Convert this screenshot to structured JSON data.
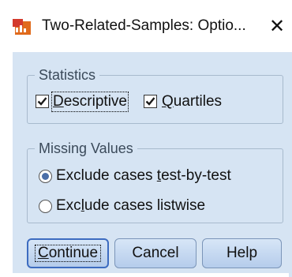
{
  "window": {
    "title": "Two-Related-Samples: Optio...",
    "icon": "spss-dialog-icon",
    "close": "✕"
  },
  "statistics": {
    "group_label": "Statistics",
    "descriptive": {
      "pre": "",
      "ul": "D",
      "post": "escriptive",
      "checked": true
    },
    "quartiles": {
      "pre": "",
      "ul": "Q",
      "post": "uartiles",
      "checked": true
    }
  },
  "missing": {
    "group_label": "Missing Values",
    "option1": {
      "pre": "Exclude cases ",
      "ul": "t",
      "post": "est-by-test",
      "selected": true
    },
    "option2": {
      "pre": "Exc",
      "ul": "l",
      "post": "ude cases listwise",
      "selected": false
    }
  },
  "buttons": {
    "continue": {
      "pre": "",
      "ul": "C",
      "post": "ontinue"
    },
    "cancel": {
      "label": "Cancel"
    },
    "help": {
      "label": "Help"
    }
  },
  "colors": {
    "dialog_bg": "#d6e4f3",
    "radio_dot": "#4a6ea8",
    "default_border": "#3d6cc0"
  }
}
